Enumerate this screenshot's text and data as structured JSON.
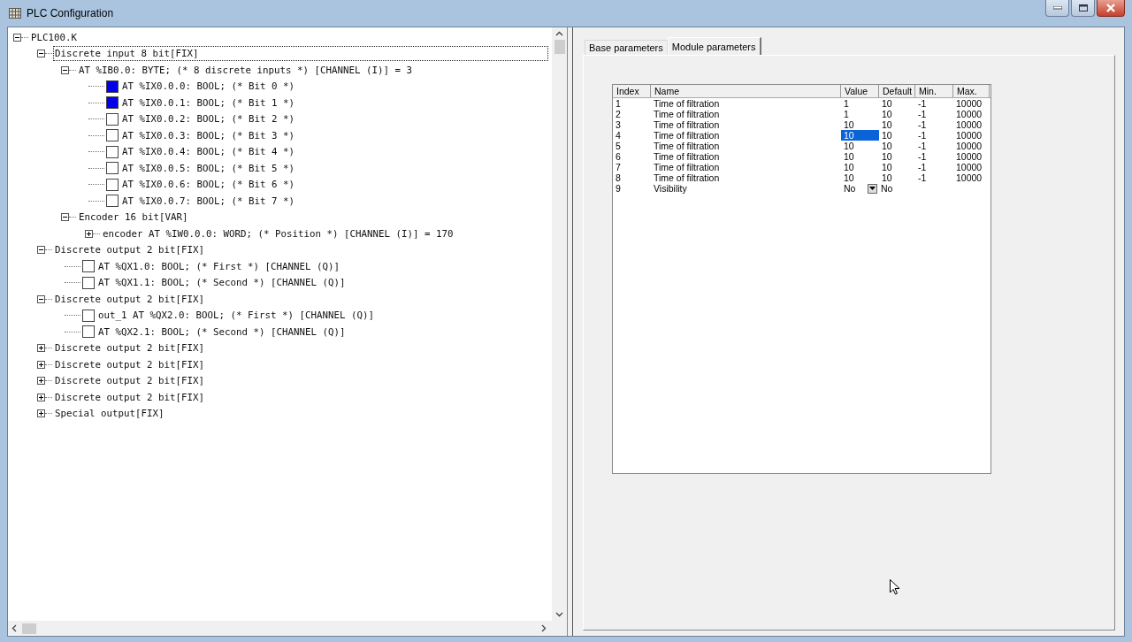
{
  "window": {
    "title": "PLC Configuration"
  },
  "tree": [
    {
      "label": "PLC100.K",
      "kind": "folder",
      "expanded": true,
      "selected": false,
      "children": [
        {
          "label": "Discrete input 8 bit[FIX]",
          "kind": "folder",
          "expanded": true,
          "selected": true,
          "children": [
            {
              "label": "AT %IB0.0: BYTE; (* 8 discrete inputs *) [CHANNEL (I)] = 3",
              "kind": "folder",
              "expanded": true,
              "selected": false,
              "children": [
                {
                  "label": "AT %IX0.0.0: BOOL; (* Bit 0 *)",
                  "kind": "channel",
                  "checked": true,
                  "selected": false
                },
                {
                  "label": "AT %IX0.0.1: BOOL; (* Bit 1 *)",
                  "kind": "channel",
                  "checked": true,
                  "selected": false
                },
                {
                  "label": "AT %IX0.0.2: BOOL; (* Bit 2 *)",
                  "kind": "channel",
                  "checked": false,
                  "selected": false
                },
                {
                  "label": "AT %IX0.0.3: BOOL; (* Bit 3 *)",
                  "kind": "channel",
                  "checked": false,
                  "selected": false
                },
                {
                  "label": "AT %IX0.0.4: BOOL; (* Bit 4 *)",
                  "kind": "channel",
                  "checked": false,
                  "selected": false
                },
                {
                  "label": "AT %IX0.0.5: BOOL; (* Bit 5 *)",
                  "kind": "channel",
                  "checked": false,
                  "selected": false
                },
                {
                  "label": "AT %IX0.0.6: BOOL; (* Bit 6 *)",
                  "kind": "channel",
                  "checked": false,
                  "selected": false
                },
                {
                  "label": "AT %IX0.0.7: BOOL; (* Bit 7 *)",
                  "kind": "channel",
                  "checked": false,
                  "selected": false
                }
              ]
            },
            {
              "label": "Encoder 16 bit[VAR]",
              "kind": "folder",
              "expanded": true,
              "selected": false,
              "children": [
                {
                  "label": "encoder AT %IW0.0.0: WORD; (* Position *) [CHANNEL (I)] = 170",
                  "kind": "folder",
                  "expanded": false,
                  "selected": false
                }
              ]
            }
          ]
        },
        {
          "label": "Discrete output 2 bit[FIX]",
          "kind": "folder",
          "expanded": true,
          "selected": false,
          "children": [
            {
              "label": "AT %QX1.0: BOOL; (* First *) [CHANNEL (Q)]",
              "kind": "channel",
              "checked": false,
              "selected": false
            },
            {
              "label": "AT %QX1.1: BOOL; (* Second *) [CHANNEL (Q)]",
              "kind": "channel",
              "checked": false,
              "selected": false
            }
          ]
        },
        {
          "label": "Discrete output 2 bit[FIX]",
          "kind": "folder",
          "expanded": true,
          "selected": false,
          "children": [
            {
              "label": "out_1 AT %QX2.0: BOOL; (* First *) [CHANNEL (Q)]",
              "kind": "channel",
              "checked": false,
              "selected": false
            },
            {
              "label": "AT %QX2.1: BOOL; (* Second *) [CHANNEL (Q)]",
              "kind": "channel",
              "checked": false,
              "selected": false
            }
          ]
        },
        {
          "label": "Discrete output 2 bit[FIX]",
          "kind": "folder",
          "expanded": false,
          "selected": false
        },
        {
          "label": "Discrete output 2 bit[FIX]",
          "kind": "folder",
          "expanded": false,
          "selected": false
        },
        {
          "label": "Discrete output 2 bit[FIX]",
          "kind": "folder",
          "expanded": false,
          "selected": false
        },
        {
          "label": "Discrete output 2 bit[FIX]",
          "kind": "folder",
          "expanded": false,
          "selected": false
        },
        {
          "label": "Special output[FIX]",
          "kind": "folder",
          "expanded": false,
          "selected": false
        }
      ]
    }
  ],
  "tabs": [
    {
      "label": "Base parameters",
      "selected": false
    },
    {
      "label": "Module parameters",
      "selected": true
    }
  ],
  "table": {
    "columns": [
      "Index",
      "Name",
      "Value",
      "Default",
      "Min.",
      "Max."
    ],
    "rows": [
      {
        "kind": "number",
        "cells": [
          "1",
          "Time of filtration",
          "1",
          "10",
          "-1",
          "10000"
        ],
        "selected": false
      },
      {
        "kind": "number",
        "cells": [
          "2",
          "Time of filtration",
          "1",
          "10",
          "-1",
          "10000"
        ],
        "selected": false
      },
      {
        "kind": "number",
        "cells": [
          "3",
          "Time of filtration",
          "10",
          "10",
          "-1",
          "10000"
        ],
        "selected": false
      },
      {
        "kind": "number",
        "cells": [
          "4",
          "Time of filtration",
          "10",
          "10",
          "-1",
          "10000"
        ],
        "selected": true
      },
      {
        "kind": "number",
        "cells": [
          "5",
          "Time of filtration",
          "10",
          "10",
          "-1",
          "10000"
        ],
        "selected": false
      },
      {
        "kind": "number",
        "cells": [
          "6",
          "Time of filtration",
          "10",
          "10",
          "-1",
          "10000"
        ],
        "selected": false
      },
      {
        "kind": "number",
        "cells": [
          "7",
          "Time of filtration",
          "10",
          "10",
          "-1",
          "10000"
        ],
        "selected": false
      },
      {
        "kind": "number",
        "cells": [
          "8",
          "Time of filtration",
          "10",
          "10",
          "-1",
          "10000"
        ],
        "selected": false
      },
      {
        "kind": "dropdown",
        "cells": [
          "9",
          "Visibility",
          "No",
          "No"
        ],
        "selected": false
      }
    ]
  }
}
